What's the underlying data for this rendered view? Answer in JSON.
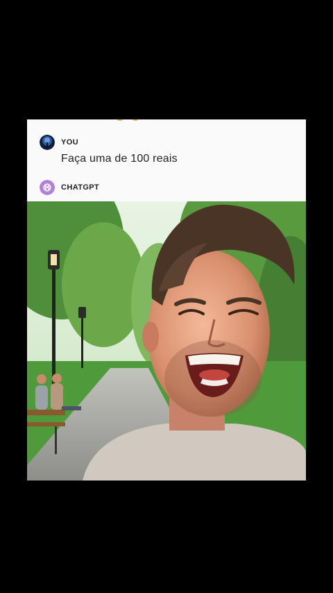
{
  "chat": {
    "user_label": "YOU",
    "user_message": "Faça uma de 100 reais",
    "assistant_label": "CHATGPT"
  },
  "colors": {
    "page_background": "#000000",
    "card_background": "#ffffff",
    "assistant_avatar": "#b57fd9",
    "user_avatar": "#1b3a66"
  },
  "icons": {
    "user_avatar": "user-avatar-icon",
    "assistant_avatar": "chatgpt-logo-icon"
  },
  "image": {
    "description_hidden": ""
  }
}
